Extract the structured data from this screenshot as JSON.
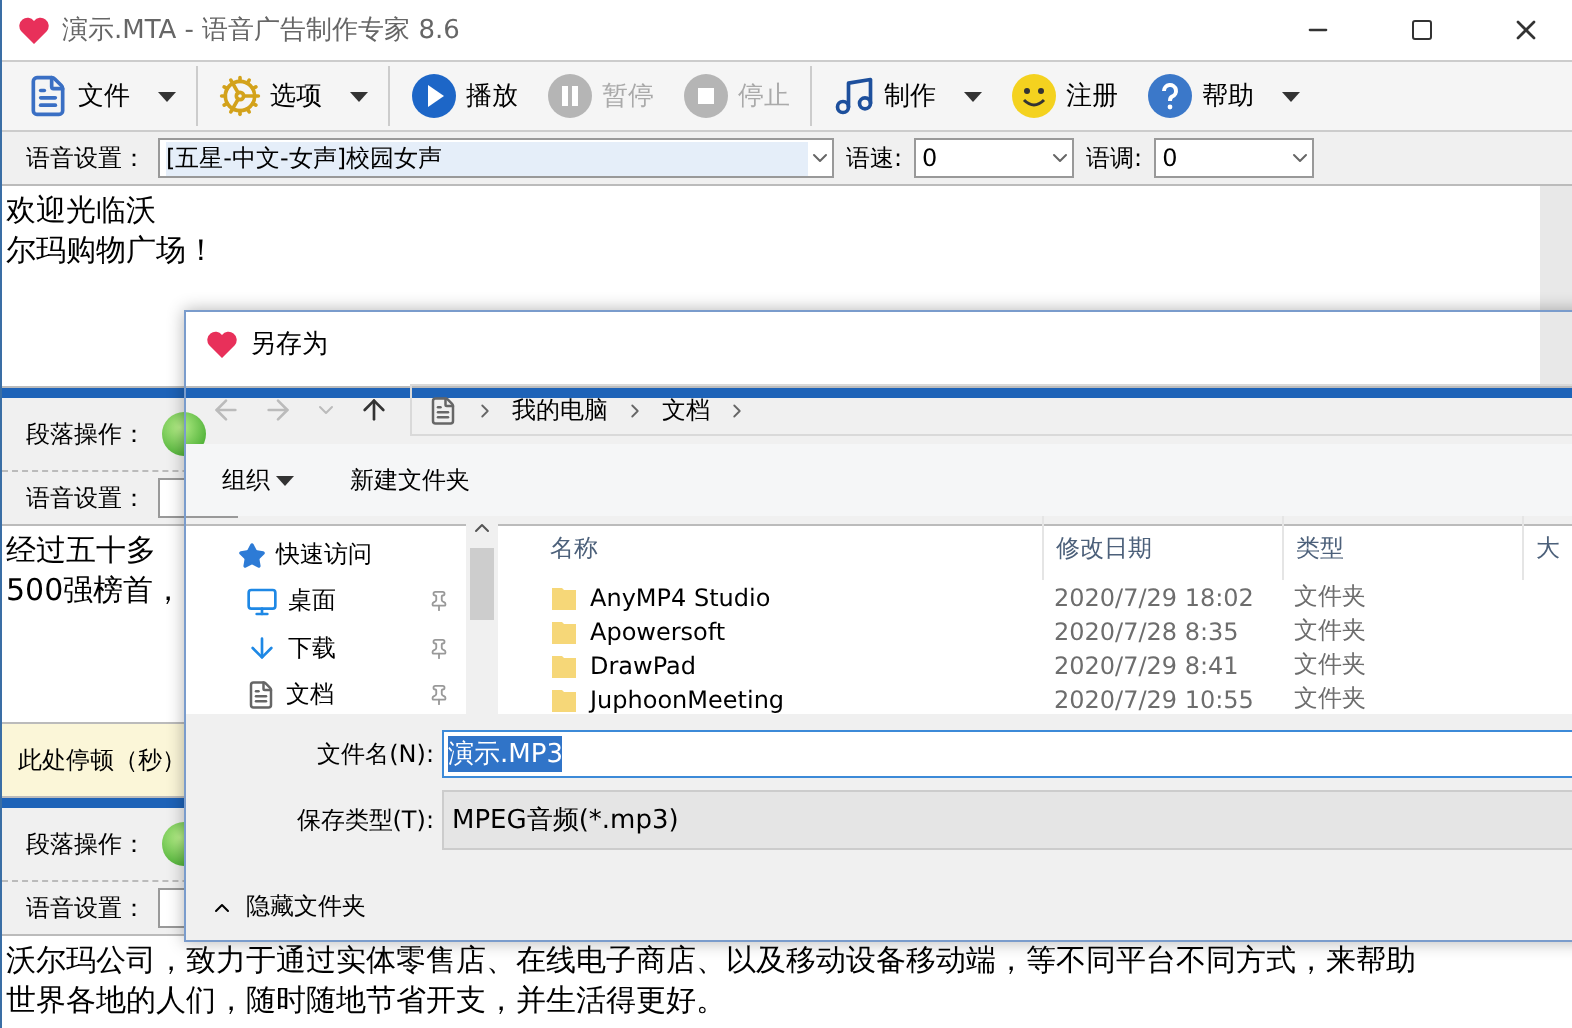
{
  "window": {
    "title": "演示.MTA - 语音广告制作专家 8.6"
  },
  "toolbar": [
    {
      "label": "文件",
      "kind": "dropdown",
      "disabled": false
    },
    {
      "label": "选项",
      "kind": "dropdown",
      "disabled": false
    },
    {
      "label": "播放",
      "kind": "button",
      "disabled": false
    },
    {
      "label": "暂停",
      "kind": "button",
      "disabled": true
    },
    {
      "label": "停止",
      "kind": "button",
      "disabled": true
    },
    {
      "label": "制作",
      "kind": "dropdown",
      "disabled": false
    },
    {
      "label": "注册",
      "kind": "button",
      "disabled": false
    },
    {
      "label": "帮助",
      "kind": "dropdown",
      "disabled": false
    }
  ],
  "voice_bar": {
    "label": "语音设置：",
    "voice": "[五星-中文-女声]校园女声",
    "speed_label": "语速:",
    "speed": "0",
    "pitch_label": "语调:",
    "pitch": "0"
  },
  "intro": {
    "lines": [
      "欢迎光临沃",
      "尔玛购物广场！"
    ]
  },
  "segments": [
    {
      "ops_label": "段落操作：",
      "voice_label": "语音设置：",
      "lines": [
        "经过五十多",
        "500强榜首，"
      ],
      "pause_label": "此处停顿（秒）"
    },
    {
      "ops_label": "段落操作：",
      "voice_label": "语音设置：",
      "lines": [
        "沃尔玛公司，致力于通过实体零售店、在线电子商店、以及移动设备移动端，等不同平台不同方式，来帮助",
        "世界各地的人们，随时随地节省开支，并生活得更好。"
      ]
    }
  ],
  "dialog": {
    "title": "另存为",
    "breadcrumb": [
      "我的电脑",
      "文档"
    ],
    "organize": "组织",
    "new_folder": "新建文件夹",
    "nav": [
      {
        "label": "快速访问",
        "kind": "group",
        "pinned": false
      },
      {
        "label": "桌面",
        "kind": "item",
        "pinned": true
      },
      {
        "label": "下载",
        "kind": "item",
        "pinned": true
      },
      {
        "label": "文档",
        "kind": "item",
        "pinned": true
      }
    ],
    "columns": [
      "名称",
      "修改日期",
      "类型",
      "大"
    ],
    "files": [
      {
        "name": "AnyMP4 Studio",
        "date": "2020/7/29 18:02",
        "type": "文件夹"
      },
      {
        "name": "Apowersoft",
        "date": "2020/7/28 8:35",
        "type": "文件夹"
      },
      {
        "name": "DrawPad",
        "date": "2020/7/29 8:41",
        "type": "文件夹"
      },
      {
        "name": "JuphoonMeeting",
        "date": "2020/7/29 10:55",
        "type": "文件夹"
      }
    ],
    "filename_label": "文件名(N):",
    "filename": "演示.MP3",
    "filetype_label": "保存类型(T):",
    "filetype": "MPEG音频(*.mp3)",
    "hide_folders": "隐藏文件夹"
  }
}
